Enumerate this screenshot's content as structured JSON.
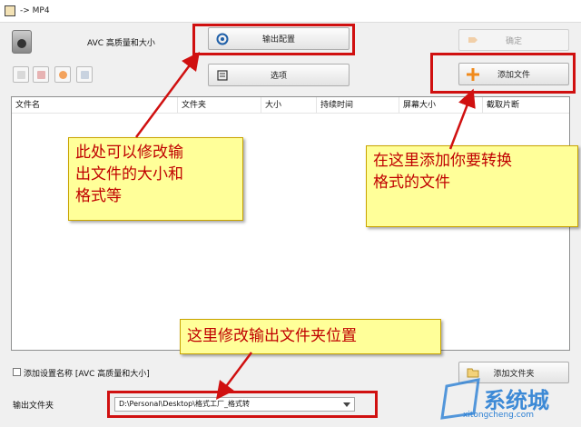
{
  "window": {
    "title": "-> MP4"
  },
  "profile": {
    "name": "AVC 高质量和大小"
  },
  "toolbar": {
    "output_config_label": "输出配置",
    "options_label": "选项",
    "ok_label": "确定",
    "add_file_label": "添加文件",
    "add_folder_label": "添加文件夹"
  },
  "table": {
    "columns": [
      "文件名",
      "文件夹",
      "大小",
      "持续时间",
      "屏幕大小",
      "截取片断"
    ]
  },
  "footer": {
    "append_setting_label": "添加设置名称 [AVC 高质量和大小]",
    "output_folder_label": "输出文件夹",
    "output_folder_value": "D:\\Personal\\Desktop\\格式工厂_格式转"
  },
  "annotations": {
    "left_lines": [
      "此处可以修改输",
      "出文件的大小和",
      "格式等"
    ],
    "right_lines": [
      "在这里添加你要转换",
      "格式的文件"
    ],
    "bottom_text": "这里修改输出文件夹位置"
  },
  "watermark": {
    "text": "系统城",
    "url": "xitongcheng.com"
  },
  "colors": {
    "annotation_red": "#d01010",
    "callout_bg": "#ffff99",
    "watermark_blue": "#2a7fd4"
  }
}
